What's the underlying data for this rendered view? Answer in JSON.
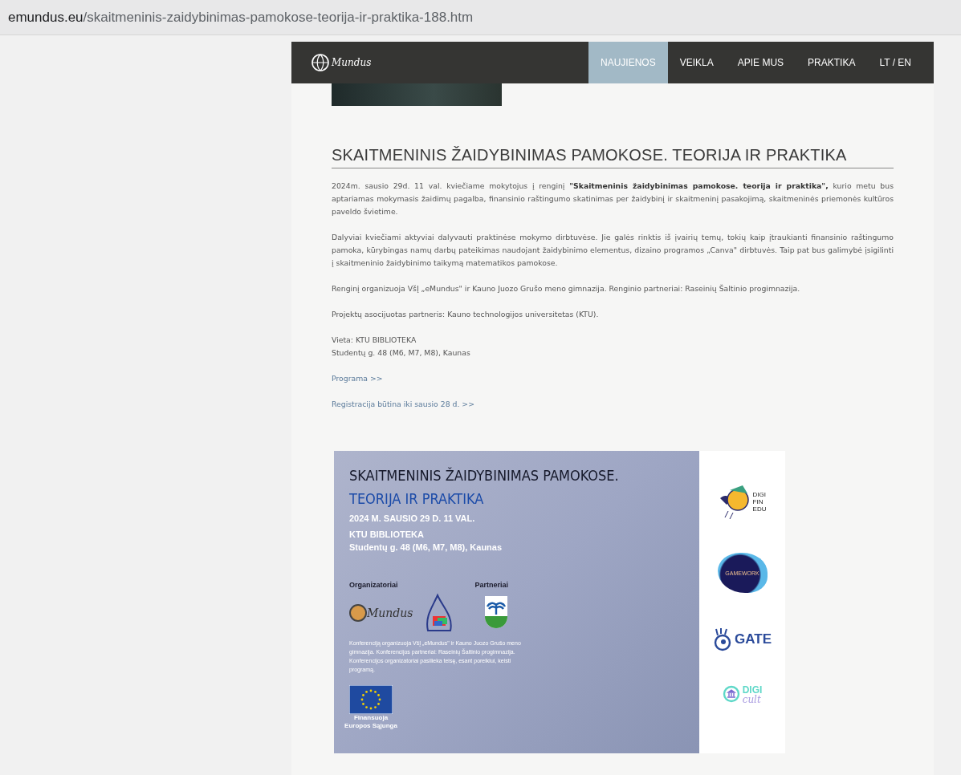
{
  "address_bar": {
    "domain": "emundus.eu",
    "path": "/skaitmeninis-zaidybinimas-pamokose-teorija-ir-praktika-188.htm"
  },
  "nav": {
    "logo": "Mundus",
    "items": [
      {
        "label": "NAUJIENOS",
        "selected": true
      },
      {
        "label": "VEIKLA",
        "selected": false
      },
      {
        "label": "APIE MUS",
        "selected": false
      },
      {
        "label": "PRAKTIKA",
        "selected": false
      },
      {
        "label": "LT / EN",
        "selected": false
      }
    ]
  },
  "article": {
    "title": "SKAITMENINIS ŽAIDYBINIMAS PAMOKOSE. TEORIJA IR PRAKTIKA",
    "paragraphs": [
      [
        "2024m. sausio 29d. 11 val. kviečiame mokytojus į renginį **\"Skaitmeninis žaidybinimas pamokose. teorija ir praktika\",** kurio metu bus aptariamas mokymasis žaidimų pagalba, finansinio raštingumo skatinimas per žaidybinį ir skaitmeninį pasakojimą,  skaitmeninės priemonės kultūros paveldo švietime."
      ],
      [
        "Dalyviai kviečiami aktyviai dalyvauti praktinėse mokymo dirbtuvėse. Jie galės rinktis iš įvairių temų, tokių kaip įtraukianti finansinio raštingumo pamoka, kūrybingas namų darbų pateikimas naudojant žaidybinimo elementus, dizaino programos „Canva\" dirbtuvės. Taip pat bus galimybė įsigilinti į skaitmeninio žaidybinimo taikymą matematikos pamokose."
      ],
      [
        "Renginį organizuoja VšĮ „eMundus\" ir Kauno Juozo Grušo meno gimnazija. Renginio partneriai: Raseinių Šaltinio progimnazija."
      ],
      [
        "Projektų asocijuotas partneris: Kauno technologijos universitetas (KTU)."
      ],
      [
        "Vieta: KTU BIBLIOTEKA",
        "Studentų g. 48 (M6, M7, M8), Kaunas"
      ]
    ],
    "links": [
      "Programa >>",
      "Registracija būtina iki sausio 28 d. >>"
    ]
  },
  "poster": {
    "title": "SKAITMENINIS ŽAIDYBINIMAS PAMOKOSE.",
    "subtitle": "TEORIJA IR PRAKTIKA",
    "details": [
      "2024 M. SAUSIO 29 D.  11 VAL.",
      "KTU  BIBLIOTEKA",
      "Studentų g. 48 (M6, M7, M8), Kaunas"
    ],
    "organizers_label": "Organizatoriai",
    "partners_label": "Partneriai",
    "organizer_logo": "Mundus",
    "note": "Konferenciją organizuoja VšĮ „eMundus\" ir Kauno Juozo Grušo meno gimnazija. Konferencijos partneriai: Raseinių Šaltinio progimnazija. Konferencijos organizatoriai pasilieka teisę, esant poreikiui, keisti programą.",
    "eu_caption": [
      "Finansuoja",
      "Europos Sąjunga"
    ],
    "logos": [
      {
        "kind": "digifin",
        "text": [
          "DIGI",
          "FIN",
          "EDU"
        ]
      },
      {
        "kind": "gamework",
        "text": [
          "GAMEWORK"
        ]
      },
      {
        "kind": "gate",
        "text": [
          "GATE"
        ]
      },
      {
        "kind": "digicult",
        "text": [
          "DIGI",
          "cult"
        ]
      }
    ]
  }
}
